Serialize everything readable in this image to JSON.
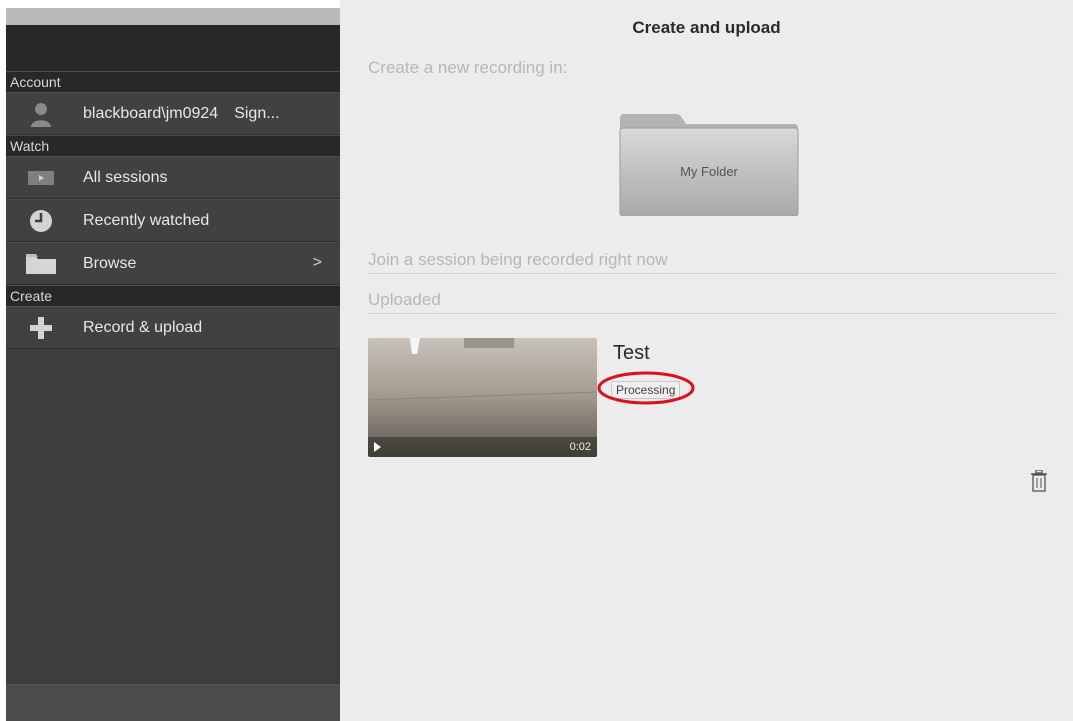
{
  "sidebar": {
    "sections": {
      "account": "Account",
      "watch": "Watch",
      "create": "Create"
    },
    "account_user": "blackboard\\jm0924",
    "account_sign": "Sign...",
    "items": {
      "all_sessions": "All sessions",
      "recently_watched": "Recently watched",
      "browse": "Browse",
      "record_upload": "Record & upload"
    },
    "browse_chevron": ">"
  },
  "main": {
    "title": "Create and upload",
    "create_new_label": "Create a new recording in:",
    "folder_name": "My Folder",
    "join_label": "Join a session being recorded right now",
    "uploaded_label": "Uploaded",
    "recording": {
      "title": "Test",
      "status": "Processing",
      "duration": "0:02"
    }
  },
  "colors": {
    "sidebar_bg": "#3b3d3e",
    "main_bg": "#ececec",
    "annotation": "#d9121b"
  }
}
